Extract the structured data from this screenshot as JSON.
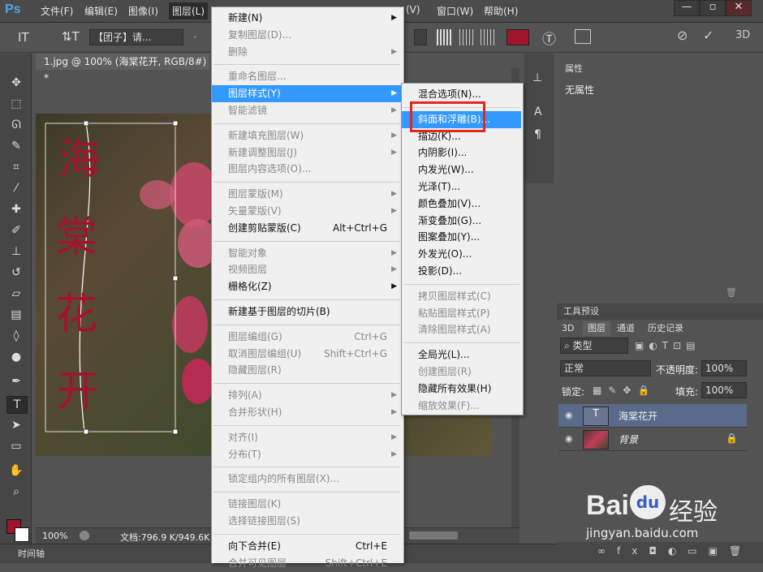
{
  "app": {
    "logo": "Ps"
  },
  "menubar": {
    "items": [
      "文件(F)",
      "编辑(E)",
      "图像(I)",
      "图层(L)",
      "(V)",
      "窗口(W)",
      "帮助(H)"
    ]
  },
  "window_controls": {
    "minimize": "—",
    "restore": "▫",
    "close": "✕"
  },
  "options": {
    "font_family": "【团子】请...",
    "color_swatch": "#a2142b",
    "dash": "-",
    "three_d": "3D"
  },
  "document": {
    "tab_title": "1.jpg @ 100% (海棠花开, RGB/8#) *",
    "zoom": "100%",
    "doc_info": "文档:796.9 K/949.6K",
    "canvas_text": [
      "海",
      "棠",
      "花",
      "开"
    ]
  },
  "timeline": {
    "label": "时间轴"
  },
  "layer_menu": {
    "items": [
      {
        "label": "新建(N)",
        "arrow": true
      },
      {
        "label": "复制图层(D)...",
        "disabled": true
      },
      {
        "label": "删除",
        "disabled": true,
        "arrow": true
      },
      {
        "sep": true
      },
      {
        "label": "重命名图层...",
        "disabled": true
      },
      {
        "label": "图层样式(Y)",
        "arrow": true,
        "highlight": true
      },
      {
        "label": "智能滤镜",
        "disabled": true,
        "arrow": true
      },
      {
        "sep": true
      },
      {
        "label": "新建填充图层(W)",
        "disabled": true,
        "arrow": true
      },
      {
        "label": "新建调整图层(J)",
        "disabled": true,
        "arrow": true
      },
      {
        "label": "图层内容选项(O)...",
        "disabled": true
      },
      {
        "sep": true
      },
      {
        "label": "图层蒙版(M)",
        "disabled": true,
        "arrow": true
      },
      {
        "label": "矢量蒙版(V)",
        "disabled": true,
        "arrow": true
      },
      {
        "label": "创建剪贴蒙版(C)",
        "shortcut": "Alt+Ctrl+G"
      },
      {
        "sep": true
      },
      {
        "label": "智能对象",
        "disabled": true,
        "arrow": true
      },
      {
        "label": "视频图层",
        "disabled": true,
        "arrow": true
      },
      {
        "label": "栅格化(Z)",
        "arrow": true
      },
      {
        "sep": true
      },
      {
        "label": "新建基于图层的切片(B)"
      },
      {
        "sep": true
      },
      {
        "label": "图层编组(G)",
        "disabled": true,
        "shortcut": "Ctrl+G"
      },
      {
        "label": "取消图层编组(U)",
        "disabled": true,
        "shortcut": "Shift+Ctrl+G"
      },
      {
        "label": "隐藏图层(R)",
        "disabled": true
      },
      {
        "sep": true
      },
      {
        "label": "排列(A)",
        "disabled": true,
        "arrow": true
      },
      {
        "label": "合并形状(H)",
        "disabled": true,
        "arrow": true
      },
      {
        "sep": true
      },
      {
        "label": "对齐(I)",
        "disabled": true,
        "arrow": true
      },
      {
        "label": "分布(T)",
        "disabled": true,
        "arrow": true
      },
      {
        "sep": true
      },
      {
        "label": "锁定组内的所有图层(X)...",
        "disabled": true
      },
      {
        "sep": true
      },
      {
        "label": "链接图层(K)",
        "disabled": true
      },
      {
        "label": "选择链接图层(S)",
        "disabled": true
      },
      {
        "sep": true
      },
      {
        "label": "向下合并(E)",
        "shortcut": "Ctrl+E"
      },
      {
        "label": "合并可见图层",
        "disabled": true,
        "shortcut": "Shift+Ctrl+E"
      }
    ]
  },
  "style_submenu": {
    "items": [
      {
        "label": "混合选项(N)..."
      },
      {
        "sep": true
      },
      {
        "label": "斜面和浮雕(B)...",
        "highlight": true
      },
      {
        "label": "描边(K)..."
      },
      {
        "label": "内阴影(I)..."
      },
      {
        "label": "内发光(W)..."
      },
      {
        "label": "光泽(T)..."
      },
      {
        "label": "颜色叠加(V)..."
      },
      {
        "label": "渐变叠加(G)..."
      },
      {
        "label": "图案叠加(Y)..."
      },
      {
        "label": "外发光(O)..."
      },
      {
        "label": "投影(D)..."
      },
      {
        "sep": true
      },
      {
        "label": "拷贝图层样式(C)",
        "disabled": true
      },
      {
        "label": "粘贴图层样式(P)",
        "disabled": true
      },
      {
        "label": "清除图层样式(A)",
        "disabled": true
      },
      {
        "sep": true
      },
      {
        "label": "全局光(L)..."
      },
      {
        "label": "创建图层(R)",
        "disabled": true
      },
      {
        "label": "隐藏所有效果(H)"
      },
      {
        "label": "缩放效果(F)...",
        "disabled": true
      }
    ]
  },
  "properties_panel": {
    "tab": "属性",
    "content": "无属性"
  },
  "tool_presets": {
    "tab": "工具预设"
  },
  "layers_panel": {
    "tabs": [
      "3D",
      "图层",
      "通道",
      "历史记录"
    ],
    "filter_kind": "类型",
    "blend_mode": "正常",
    "opacity_label": "不透明度:",
    "opacity": "100%",
    "lock_label": "锁定:",
    "fill_label": "填充:",
    "fill": "100%",
    "layers": [
      {
        "name": "海棠花开",
        "type": "text",
        "selected": true
      },
      {
        "name": "背景",
        "type": "image",
        "locked": true
      }
    ]
  },
  "watermark": {
    "brand": "Bai",
    "paw": "du",
    "cn": "经验",
    "url": "jingyan.baidu.com"
  },
  "colors": {
    "accent": "#3399ff",
    "highlight_box": "#e8251b",
    "fg_color": "#a2142b"
  }
}
